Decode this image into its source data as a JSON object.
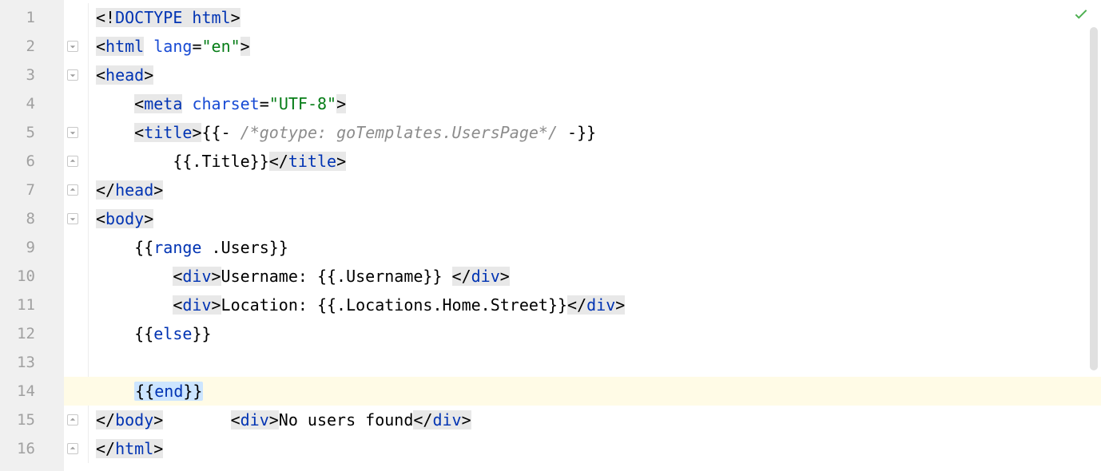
{
  "gutter": {
    "numbers": [
      "1",
      "2",
      "3",
      "4",
      "5",
      "6",
      "7",
      "8",
      "9",
      "10",
      "11",
      "12",
      "13",
      "14",
      "15",
      "16"
    ]
  },
  "status": {
    "inspection": "ok"
  },
  "fold_markers": {
    "line2": "open-down",
    "line3": "open-down",
    "line5": "open-down",
    "line6": "open-up",
    "line7": "open-up",
    "line8": "open-down",
    "line15": "open-up",
    "line16": "open-up"
  },
  "code": {
    "l1": {
      "p": [
        "<!",
        "DOCTYPE ",
        "html",
        ">"
      ]
    },
    "l2": {
      "p": [
        "<",
        "html",
        " ",
        "lang",
        "=",
        "\"en\"",
        ">"
      ]
    },
    "l3": {
      "p": [
        "<",
        "head",
        ">"
      ]
    },
    "l4": {
      "p": [
        "    ",
        "<",
        "meta",
        " ",
        "charset",
        "=",
        "\"UTF-8\"",
        ">"
      ]
    },
    "l5": {
      "p": [
        "    ",
        "<",
        "title",
        ">",
        "{{- ",
        "/*gotype: goTemplates.UsersPage*/",
        " -}}"
      ]
    },
    "l6": {
      "p": [
        "        ",
        "{{.Title}}",
        "</",
        "title",
        ">"
      ]
    },
    "l7": {
      "p": [
        "</",
        "head",
        ">"
      ]
    },
    "l8": {
      "p": [
        "<",
        "body",
        ">"
      ]
    },
    "l9": {
      "p": [
        "    ",
        "{{",
        "range",
        " .Users}}"
      ]
    },
    "l10": {
      "p": [
        "        ",
        "<",
        "div",
        ">",
        "Username: {{.Username}} ",
        "</",
        "div",
        ">"
      ]
    },
    "l11": {
      "p": [
        "        ",
        "<",
        "div",
        ">",
        "Location: {{.Locations.Home.Street}}",
        "</",
        "div",
        ">"
      ]
    },
    "l12": {
      "p": [
        "    ",
        "{{",
        "else",
        "}}"
      ]
    },
    "l13": {
      "p": [
        "        ",
        "<",
        "div",
        ">",
        "No users found",
        "</",
        "div",
        ">"
      ]
    },
    "l14": {
      "p": [
        "    ",
        "{{",
        "end",
        "}}"
      ]
    },
    "l15": {
      "p": [
        "</",
        "body",
        ">"
      ]
    },
    "l16": {
      "p": [
        "</",
        "html",
        ">"
      ]
    }
  },
  "highlights": {
    "current_line": 14,
    "selection_line14": "{{end}}",
    "bulb_line": 13
  }
}
